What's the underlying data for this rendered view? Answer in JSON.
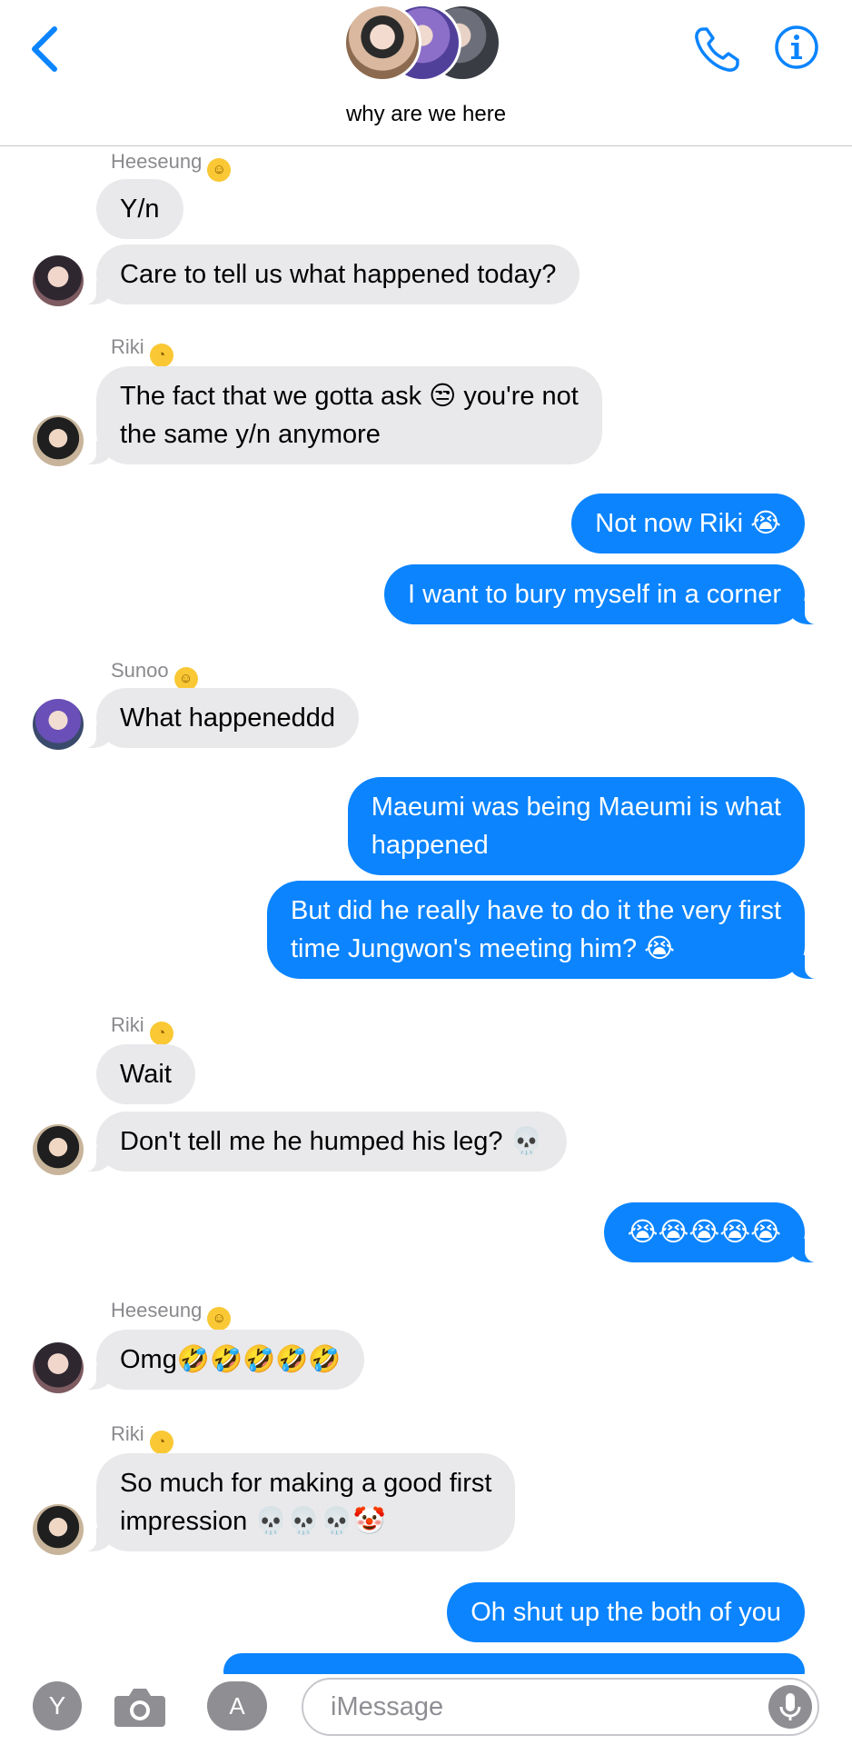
{
  "header": {
    "group_name": "why are we here",
    "colors": {
      "accent": "#0b84fe"
    }
  },
  "messages": [
    {
      "sender": "Heeseung",
      "sender_emoji": "relieved",
      "side": "in",
      "text": "Y/n"
    },
    {
      "side": "in",
      "text": "Care to tell us what happened today?"
    },
    {
      "sender": "Riki",
      "sender_emoji": "woozy",
      "side": "in",
      "text": "The fact that we gotta ask 😒 you're not\nthe same y/n anymore"
    },
    {
      "side": "out",
      "text": "Not now Riki 😭"
    },
    {
      "side": "out",
      "text": "I want to bury myself in a corner"
    },
    {
      "sender": "Sunoo",
      "sender_emoji": "smiling",
      "side": "in",
      "text": "What happeneddd"
    },
    {
      "side": "out",
      "text": "Maeumi was being Maeumi is what\nhappened"
    },
    {
      "side": "out",
      "text": "But did he really have to do it the very first\ntime Jungwon's meeting him? 😭"
    },
    {
      "sender": "Riki",
      "sender_emoji": "woozy",
      "side": "in",
      "text": "Wait"
    },
    {
      "side": "in",
      "text": "Don't tell me he humped his leg? 💀"
    },
    {
      "side": "out",
      "text": "😭😭😭😭😭"
    },
    {
      "sender": "Heeseung",
      "sender_emoji": "relieved",
      "side": "in",
      "text": "Omg🤣🤣🤣🤣🤣"
    },
    {
      "sender": "Riki",
      "sender_emoji": "woozy",
      "side": "in",
      "text": "So much for making a good first\nimpression 💀💀💀🤡"
    },
    {
      "side": "out",
      "text": "Oh shut up the both of you"
    }
  ],
  "senders": {
    "heeseung": "Heeseung",
    "riki": "Riki",
    "sunoo": "Sunoo"
  },
  "composer": {
    "placeholder": "iMessage",
    "app_initial": "Y"
  }
}
